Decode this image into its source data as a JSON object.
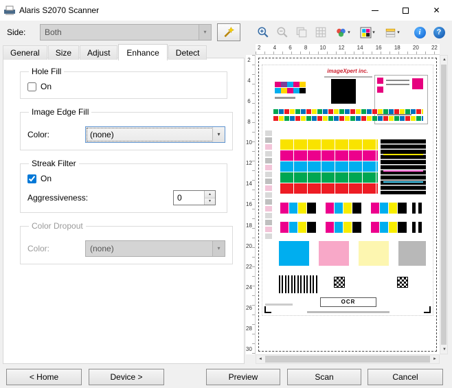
{
  "colors": {
    "accent": "#0078d7",
    "titlebar_bg": "#ffffff",
    "dialog_bg": "#f0f0f0",
    "selection_dash": "#444444"
  },
  "titlebar": {
    "title": "Alaris S2070 Scanner"
  },
  "icons": {
    "close": "✕",
    "dropdown_arrow": "▾",
    "spin_up": "▲",
    "spin_down": "▼",
    "scroll_up": "▲",
    "scroll_down": "▼",
    "scroll_left": "◄",
    "scroll_right": "►",
    "info": "i",
    "help": "?"
  },
  "side": {
    "label": "Side:",
    "value": "Both"
  },
  "tabs": {
    "items": [
      "General",
      "Size",
      "Adjust",
      "Enhance",
      "Detect"
    ],
    "active": "Enhance"
  },
  "enhance_panel": {
    "hole_fill": {
      "title": "Hole Fill",
      "on_label": "On",
      "on_checked": false
    },
    "image_edge_fill": {
      "title": "Image Edge Fill",
      "color_label": "Color:",
      "color_value": "(none)"
    },
    "streak_filter": {
      "title": "Streak Filter",
      "on_label": "On",
      "on_checked": true,
      "aggressiveness_label": "Aggressiveness:",
      "aggressiveness_value": "0"
    },
    "color_dropout": {
      "title": "Color Dropout",
      "color_label": "Color:",
      "color_value": "(none)"
    }
  },
  "preview": {
    "ruler_h": [
      "2",
      "4",
      "6",
      "8",
      "10",
      "12",
      "14",
      "16",
      "18",
      "20",
      "22"
    ],
    "ruler_v": [
      "2",
      "4",
      "6",
      "8",
      "10",
      "12",
      "14",
      "16",
      "18",
      "20",
      "22",
      "24",
      "26",
      "28",
      "30"
    ],
    "target": {
      "logo": "imageXpert inc.",
      "ocr_label": "OCR"
    }
  },
  "footer": {
    "home": "< Home",
    "device": "Device >",
    "preview": "Preview",
    "scan": "Scan",
    "cancel": "Cancel"
  }
}
